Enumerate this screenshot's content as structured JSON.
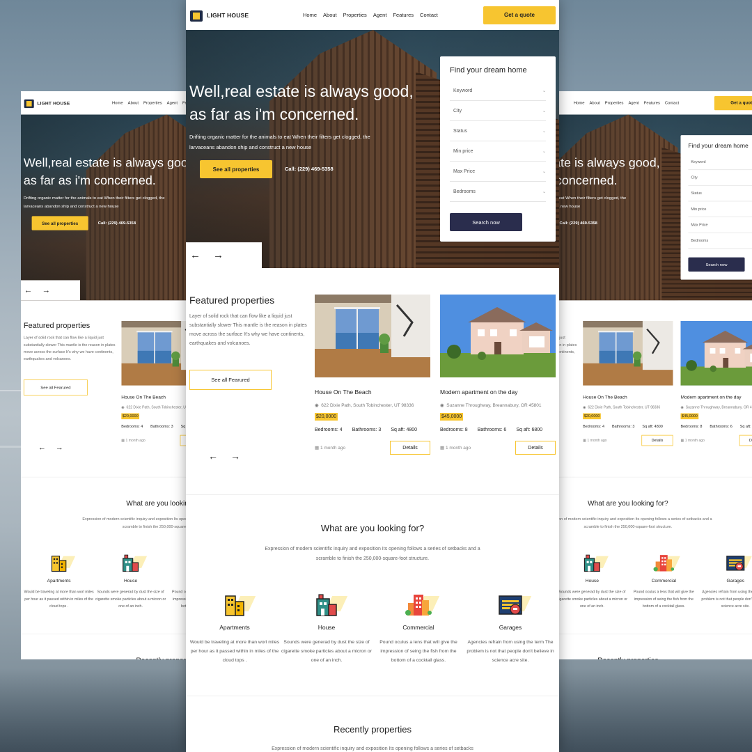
{
  "brand": {
    "name": "LIGHT HOUSE"
  },
  "nav": {
    "items": [
      "Home",
      "About",
      "Properties",
      "Agent",
      "Features",
      "Contact"
    ],
    "cta": "Get a quote"
  },
  "hero": {
    "title": "Well,real estate is always good, as far as i'm concerned.",
    "subtitle": "Drifting organic matter for the animals to eat When their filters get clogged, the larvaceans abandon ship and construct a new house",
    "button": "See all properties",
    "call": "Call: (229) 469-5358"
  },
  "search": {
    "title": "Find your dream home",
    "fields": [
      "Keyword",
      "City",
      "Status",
      "Min price",
      "Max Price",
      "Bedrooms"
    ],
    "button": "Search now"
  },
  "featured": {
    "title": "Featured properties",
    "text": "Layer of solid rock that can flow like a liquid just substantially slower This mantle is the reason in plates move across the surface It's why we have continents, earthquakes and volcanoes.",
    "button": "See all Fearured",
    "cards": [
      {
        "title": "House On The Beach",
        "address": "622 Dixie Path, South Tobinchester, UT 98336",
        "price": "$20,0000",
        "bedrooms": "Bedrooms: 4",
        "bathrooms": "Bathrooms: 3",
        "sqft": "Sq aft: 4800",
        "ago": "1 month ago",
        "details": "Details"
      },
      {
        "title": "Modern apartment on the day",
        "address": "Suzanne Throughway, Breannabury, OR 45801",
        "price": "$45,0000",
        "bedrooms": "Bedrooms: 8",
        "bathrooms": "Bathrooms: 6",
        "sqft": "Sq aft: 6800",
        "ago": "1 month ago",
        "details": "Details"
      }
    ]
  },
  "looking": {
    "title": "What are you looking for?",
    "subtitle": "Expression of modern scientific inquiry and exposition Its opening follows a series of setbacks and a scramble to finish the 250,000-square-foot structure.",
    "categories": [
      {
        "name": "Apartments",
        "desc": "Would be traveling at more than worl miles per hour as it passed within in miles of the cloud tops .",
        "icon": "apartment-building-icon"
      },
      {
        "name": "House",
        "desc": "Sounds were generad by dust the size of cigarette smoke particles about a micron or one of an inch.",
        "icon": "house-icon"
      },
      {
        "name": "Commercial",
        "desc": "Pound oculus a lens that will give the impression of seing the fish from the bottom of a cocktail glass.",
        "icon": "commercial-building-icon"
      },
      {
        "name": "Garages",
        "desc": "Agencies refrain from using the term The problem is not that people don't believe in science acre site.",
        "icon": "garage-icon"
      }
    ]
  },
  "recent": {
    "title": "Recently properties",
    "subtitle": "Expression of modern scientific inquiry and exposition Its opening follows a series of setbacks"
  },
  "colors": {
    "accent": "#f7c530",
    "dark": "#2a2d4d"
  }
}
